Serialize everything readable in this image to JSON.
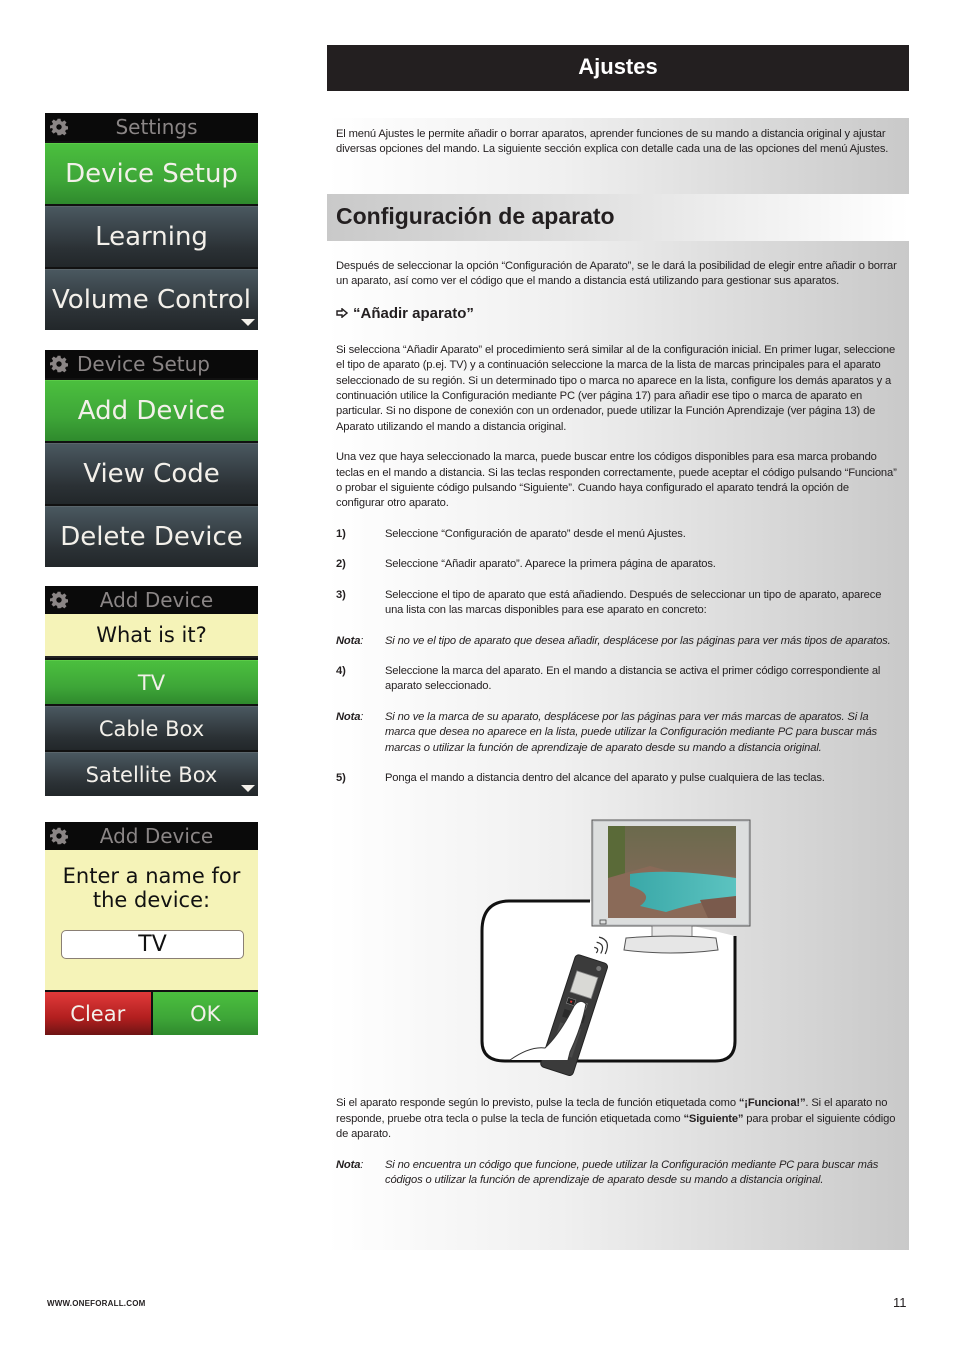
{
  "screens": {
    "settings": {
      "header": "Settings",
      "items": [
        "Device Setup",
        "Learning",
        "Volume Control"
      ],
      "selected_index": 0,
      "has_more": true
    },
    "device_setup": {
      "header": "Device Setup",
      "items": [
        "Add Device",
        "View Code",
        "Delete Device"
      ],
      "selected_index": 0
    },
    "add_device_type": {
      "header": "Add Device",
      "question": "What is it?",
      "items": [
        "TV",
        "Cable Box",
        "Satellite Box"
      ],
      "selected_index": 0,
      "has_more": true
    },
    "add_device_name": {
      "header": "Add Device",
      "prompt_line1": "Enter a name for",
      "prompt_line2": "the device:",
      "name_value": "TV",
      "clear_label": "Clear",
      "ok_label": "OK"
    }
  },
  "page": {
    "title": "Ajustes",
    "intro": "El menú Ajustes le permite añadir o borrar aparatos, aprender funciones de su mando a distancia original y ajustar diversas opciones del mando. La siguiente sección explica con detalle cada una de las opciones del menú Ajustes.",
    "section_title": "Configuración de aparato",
    "section_intro": "Después de seleccionar la opción “Configuración de Aparato”, se le dará la posibilidad de elegir entre añadir o borrar un aparato, así como ver el código que el mando a distancia está utilizando para gestionar sus aparatos.",
    "subsection_title": "“Añadir aparato”",
    "para1": "Si selecciona “Añadir Aparato” el procedimiento será similar al de la configuración inicial. En primer lugar, seleccione el tipo de aparato (p.ej. TV) y a continuación seleccione la marca de la lista de marcas principales para el aparato seleccionado de su región. Si un determinado tipo o marca no aparece en la lista, configure los demás aparatos y a continuación utilice la Configuración mediante PC (ver página 17) para añadir ese tipo o marca de aparato en particular. Si no dispone de conexión con un ordenador, puede utilizar la Función Aprendizaje (ver página 13) de Aparato utilizando el mando a distancia original.",
    "para2": "Una vez que haya seleccionado la marca, puede buscar entre los códigos disponibles para esa marca probando teclas en el mando a distancia. Si las teclas responden correctamente, puede aceptar el código pulsando  “Funciona” o probar el siguiente código pulsando “Siguiente”. Cuando haya configurado el aparato tendrá la opción de configurar otro aparato.",
    "steps": [
      {
        "num": "1)",
        "text": "Seleccione “Configuración de aparato” desde el menú Ajustes."
      },
      {
        "num": "2)",
        "text": "Seleccione “Añadir aparato”. Aparece la primera página de aparatos."
      },
      {
        "num": "3)",
        "text": "Seleccione el tipo de aparato que está añadiendo. Después de seleccionar un tipo de aparato, aparece una lista con las marcas disponibles para ese aparato en concreto:"
      },
      {
        "num": "4)",
        "text": "Seleccione la marca del aparato. En el mando a distancia se activa el primer código correspondiente al aparato seleccionado."
      },
      {
        "num": "5)",
        "text": "Ponga el mando a distancia dentro del alcance del aparato y pulse cualquiera de las teclas."
      }
    ],
    "note_label": "Nota",
    "note_sep": ":",
    "notes": [
      "Si no ve el tipo de aparato que desea añadir, desplácese por las páginas para ver más tipos de aparatos.",
      "Si no ve la marca de su aparato, desplácese por las páginas para ver más marcas de aparatos.  Si la marca que desea no aparece en la lista, puede utilizar la Configuración mediante PC para buscar más marcas o utilizar la función de aprendizaje de aparato desde su mando a distancia original.",
      "Si no encuentra un código que funcione, puede utilizar la Configuración mediante  PC para buscar más códigos o utilizar la función de aprendizaje de aparato desde su mando a distancia original."
    ],
    "after_a": "Si el aparato responde según lo previsto, pulse la tecla de función etiquetada como ",
    "after_b": "“¡Funciona!”",
    "after_c": ". Si el aparato no responde, pruebe otra tecla o pulse la tecla de función etiquetada como ",
    "after_d": "“Siguiente”",
    "after_e": " para probar el siguiente código de aparato."
  },
  "footer": {
    "url": "WWW.ONEFORALL.COM",
    "page_number": "11"
  }
}
